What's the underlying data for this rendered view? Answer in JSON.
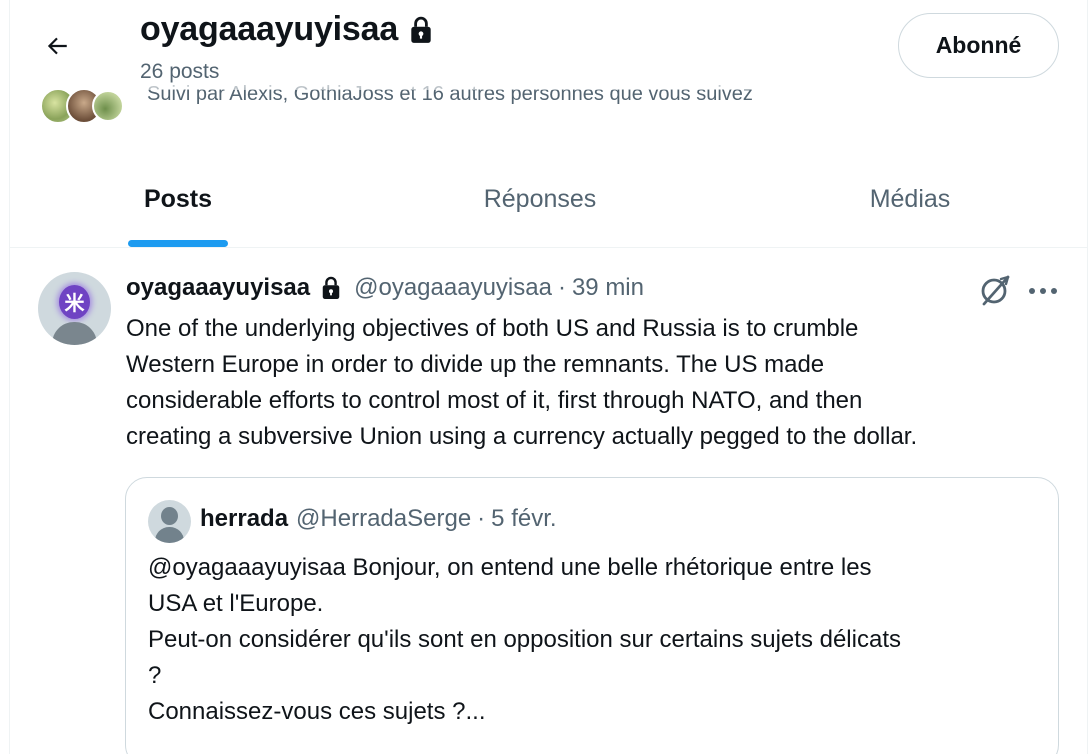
{
  "header": {
    "name": "oyagaaayuyisaa",
    "posts_count": "26 posts",
    "follow_button": "Abonné",
    "followed_by": "Suivi par Alexis, GothiaJoss et 16 autres personnes que vous suivez",
    "icons": {
      "back": "arrow-left-icon",
      "lock": "lock-icon"
    }
  },
  "tabs": [
    {
      "label": "Posts",
      "active": true
    },
    {
      "label": "Réponses",
      "active": false
    },
    {
      "label": "Médias",
      "active": false
    }
  ],
  "post": {
    "author": "oyagaaayuyisaa",
    "handle": "@oyagaaayuyisaa",
    "separator": "·",
    "time": "39 min",
    "text": "One of the underlying objectives of both US and Russia is to crumble\nWestern Europe in order to divide up the remnants. The US made\nconsiderable efforts to control most of it, first through NATO, and then\ncreating a subversive Union using a currency actually pegged to the dollar.",
    "icons": {
      "grok": "grok-icon",
      "more": "more-icon"
    },
    "quote": {
      "author": "herrada",
      "handle": "@HerradaSerge",
      "separator": "·",
      "time": "5 févr.",
      "text": "@oyagaaayuyisaa Bonjour, on entend une belle rhétorique entre les\nUSA et l'Europe.\nPeut-on considérer qu'ils sont en opposition sur certains sujets délicats\n?\nConnaissez-vous ces sujets ?..."
    }
  },
  "colors": {
    "accent": "#1d9bf0",
    "text_primary": "#0f1419",
    "text_secondary": "#536471",
    "border": "#cfd9de"
  }
}
